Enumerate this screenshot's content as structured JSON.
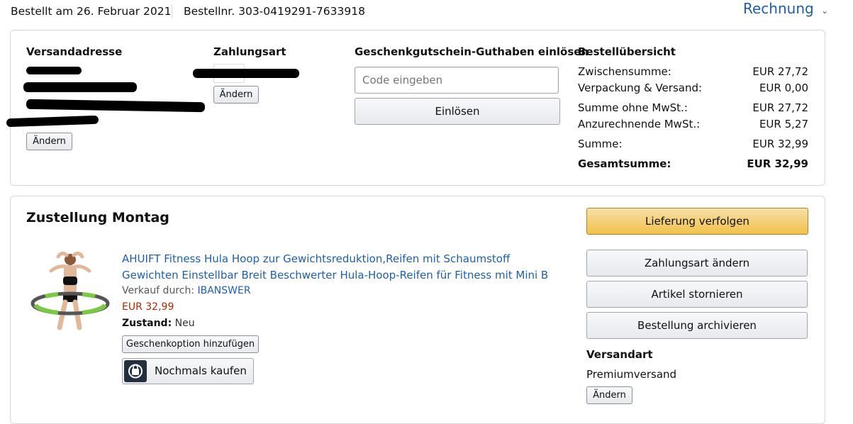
{
  "header": {
    "order_date": "Bestellt am 26. Februar 2021",
    "order_number": "Bestellnr. 303-0419291-7633918",
    "invoice_label": "Rechnung"
  },
  "summary_card": {
    "shipping_address": {
      "heading": "Versandadresse",
      "change_label": "Ändern"
    },
    "payment": {
      "heading": "Zahlungsart",
      "change_label": "Ändern"
    },
    "gift_card": {
      "heading": "Geschenkgutschein-Guthaben einlösen",
      "code_placeholder": "Code eingeben",
      "redeem_label": "Einlösen"
    },
    "order_summary": {
      "heading": "Bestellübersicht",
      "rows": [
        {
          "label": "Zwischensumme:",
          "value": "EUR 27,72"
        },
        {
          "label": "Verpackung & Versand:",
          "value": "EUR 0,00"
        },
        {
          "label": "Summe ohne MwSt.:",
          "value": "EUR 27,72"
        },
        {
          "label": "Anzurechnende MwSt.:",
          "value": "EUR 5,27"
        },
        {
          "label": "Summe:",
          "value": "EUR 32,99"
        },
        {
          "label": "Gesamtsumme:",
          "value": "EUR 32,99"
        }
      ]
    }
  },
  "delivery_card": {
    "heading": "Zustellung Montag",
    "product": {
      "title_line1": "AHUIFT Fitness Hula Hoop zur Gewichtsreduktion,Reifen mit Schaumstoff",
      "title_line2": "Gewichten Einstellbar Breit Beschwerter Hula-Hoop-Reifen für Fitness mit Mini B",
      "seller_prefix": "Verkauf durch:",
      "seller_name": "IBANSWER",
      "price": "EUR 32,99",
      "condition_label": "Zustand:",
      "condition_value": "Neu",
      "gift_option_label": "Geschenkoption hinzufügen",
      "buy_again_label": "Nochmals kaufen"
    },
    "actions": {
      "track": "Lieferung verfolgen",
      "change_payment": "Zahlungsart ändern",
      "cancel_items": "Artikel stornieren",
      "archive_order": "Bestellung archivieren"
    },
    "shipping_method": {
      "heading": "Versandart",
      "value": "Premiumversand",
      "change_label": "Ändern"
    }
  },
  "colors": {
    "link": "#1f5fa8",
    "price": "#b12704",
    "primary_button": "#f0c14b"
  }
}
